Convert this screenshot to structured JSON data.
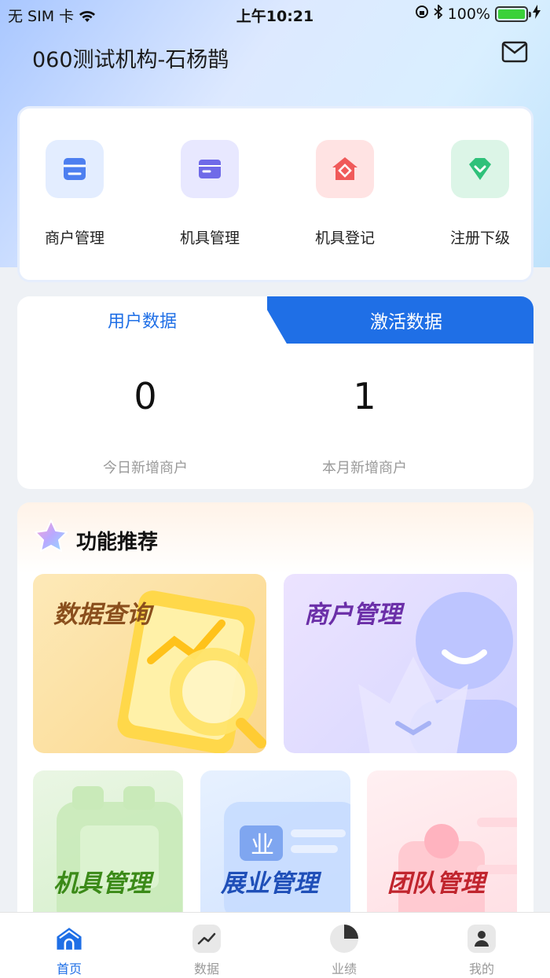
{
  "status_bar": {
    "carrier": "无 SIM 卡",
    "time": "上午10:21",
    "battery": "100%"
  },
  "header": {
    "title": "060测试机构-石杨鹊"
  },
  "quick_menu": [
    {
      "label": "商户管理",
      "icon": "store-icon",
      "color": "#4d7ff0",
      "bg": "#e3edff"
    },
    {
      "label": "机具管理",
      "icon": "device-box-icon",
      "color": "#6f6ae8",
      "bg": "#e8e8ff"
    },
    {
      "label": "机具登记",
      "icon": "register-house-icon",
      "color": "#f05a5a",
      "bg": "#ffe3e3"
    },
    {
      "label": "注册下级",
      "icon": "diamond-check-icon",
      "color": "#2fc17a",
      "bg": "#dcf5e7"
    }
  ],
  "data_panel": {
    "tabs": [
      "用户数据",
      "激活数据"
    ],
    "stats": [
      {
        "value": "0",
        "label": "今日新增商户"
      },
      {
        "value": "1",
        "label": "本月新增商户"
      }
    ]
  },
  "recommend": {
    "title": "功能推荐",
    "large_cards": [
      {
        "label": "数据查询",
        "color": "#8a4f1d"
      },
      {
        "label": "商户管理",
        "color": "#6b2fa8"
      }
    ],
    "small_cards": [
      {
        "label": "机具管理",
        "color": "#3b8a18"
      },
      {
        "label": "展业管理",
        "color": "#1f4fb8"
      },
      {
        "label": "团队管理",
        "color": "#c0242d"
      }
    ]
  },
  "tabbar": [
    {
      "label": "首页",
      "icon": "home-icon",
      "active": true
    },
    {
      "label": "数据",
      "icon": "chart-icon",
      "active": false
    },
    {
      "label": "业绩",
      "icon": "pie-icon",
      "active": false
    },
    {
      "label": "我的",
      "icon": "user-icon",
      "active": false
    }
  ],
  "colors": {
    "accent": "#1f6fe6"
  }
}
